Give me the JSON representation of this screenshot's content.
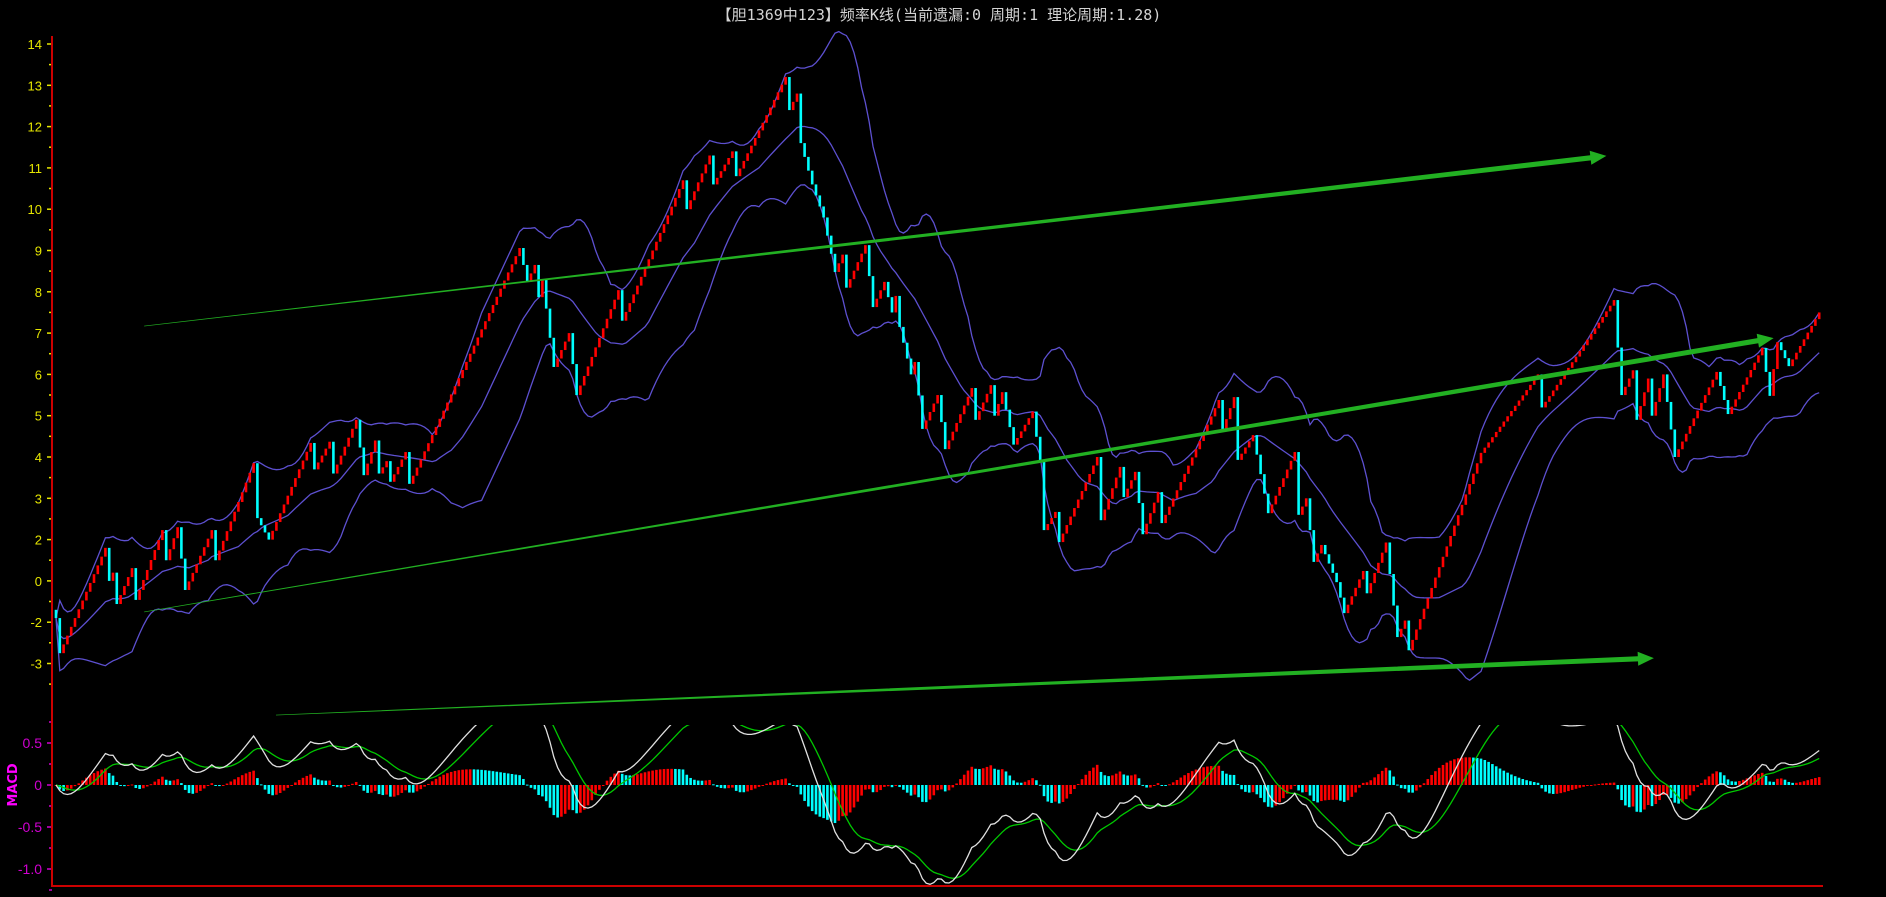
{
  "title": "【胆1369中123】频率K线(当前遗漏:0 周期:1 理论周期:1.28)",
  "colors": {
    "background": "#000000",
    "axis": "#cc0000",
    "price_tick": "#e6e600",
    "macd_tick": "#d000d0",
    "up_bar": "#ff0000",
    "down_bar": "#00ffff",
    "bands": "#5d50d0",
    "dif": "#e0e0e0",
    "dea": "#00c800",
    "trendline": "#22b022"
  },
  "chart_data": {
    "type": "candlestick",
    "title": "【胆1369中123】频率K线(当前遗漏:0 周期:1 理论周期:1.28)",
    "price_axis": {
      "range": [
        -1.9,
        14.2
      ],
      "ticks": [
        {
          "value": 14,
          "label": "14"
        },
        {
          "value": 13,
          "label": "13"
        },
        {
          "value": 12,
          "label": "12"
        },
        {
          "value": 11,
          "label": "11"
        },
        {
          "value": 10,
          "label": "10"
        },
        {
          "value": 9,
          "label": "9"
        },
        {
          "value": 8,
          "label": "8"
        },
        {
          "value": 7,
          "label": "7"
        },
        {
          "value": 6,
          "label": "6"
        },
        {
          "value": 5,
          "label": "5"
        },
        {
          "value": 4,
          "label": "4"
        },
        {
          "value": 3,
          "label": "3"
        },
        {
          "value": 2,
          "label": "2"
        },
        {
          "value": 1,
          "label": "0"
        },
        {
          "value": 0,
          "label": "-2"
        },
        {
          "value": -1,
          "label": "-3"
        }
      ]
    },
    "macd_axis": {
      "label": "MACD",
      "range": [
        -1.2,
        0.85
      ],
      "ticks": [
        {
          "value": 0.5,
          "label": "0.5"
        },
        {
          "value": 0,
          "label": "0"
        },
        {
          "value": -0.5,
          "label": "-0.5"
        },
        {
          "value": -1.0,
          "label": "-1.0"
        }
      ]
    },
    "bollinger": {
      "period": 20,
      "k": 2
    },
    "macd": {
      "fast": 12,
      "slow": 26,
      "signal": 9
    },
    "close_pivots": [
      [
        0,
        0.1
      ],
      [
        1,
        -0.75
      ],
      [
        13,
        1.8
      ],
      [
        14,
        1.0
      ],
      [
        15,
        1.2
      ],
      [
        16,
        0.44
      ],
      [
        20,
        1.31
      ],
      [
        21,
        0.54
      ],
      [
        28,
        2.23
      ],
      [
        29,
        1.5
      ],
      [
        32,
        2.3
      ],
      [
        34,
        0.78
      ],
      [
        41,
        2.23
      ],
      [
        42,
        1.5
      ],
      [
        52,
        3.85
      ],
      [
        53,
        2.52
      ],
      [
        56,
        2.0
      ],
      [
        67,
        4.34
      ],
      [
        68,
        3.7
      ],
      [
        72,
        4.37
      ],
      [
        73,
        3.6
      ],
      [
        79,
        4.9
      ],
      [
        81,
        3.56
      ],
      [
        84,
        4.4
      ],
      [
        85,
        3.6
      ],
      [
        87,
        3.9
      ],
      [
        88,
        3.4
      ],
      [
        92,
        4.12
      ],
      [
        93,
        3.35
      ],
      [
        122,
        9.06
      ],
      [
        124,
        8.24
      ],
      [
        126,
        8.65
      ],
      [
        127,
        7.87
      ],
      [
        128,
        8.3
      ],
      [
        131,
        6.18
      ],
      [
        135,
        7.0
      ],
      [
        137,
        5.5
      ],
      [
        148,
        8.04
      ],
      [
        149,
        7.3
      ],
      [
        165,
        10.7
      ],
      [
        166,
        10.0
      ],
      [
        172,
        11.3
      ],
      [
        173,
        10.6
      ],
      [
        178,
        11.4
      ],
      [
        179,
        10.8
      ],
      [
        192,
        13.2
      ],
      [
        193,
        12.4
      ],
      [
        195,
        12.8
      ],
      [
        196,
        11.6
      ],
      [
        199,
        10.6
      ],
      [
        202,
        9.8
      ],
      [
        205,
        8.48
      ],
      [
        207,
        8.9
      ],
      [
        208,
        8.1
      ],
      [
        213,
        9.13
      ],
      [
        215,
        7.63
      ],
      [
        218,
        8.24
      ],
      [
        220,
        7.5
      ],
      [
        221,
        7.9
      ],
      [
        222,
        7.15
      ],
      [
        225,
        6.0
      ],
      [
        226,
        6.3
      ],
      [
        228,
        4.68
      ],
      [
        232,
        5.5
      ],
      [
        234,
        4.19
      ],
      [
        241,
        5.67
      ],
      [
        242,
        4.9
      ],
      [
        246,
        5.74
      ],
      [
        247,
        5.0
      ],
      [
        249,
        5.57
      ],
      [
        252,
        4.3
      ],
      [
        257,
        5.1
      ],
      [
        259,
        3.88
      ],
      [
        260,
        2.23
      ],
      [
        263,
        2.67
      ],
      [
        264,
        1.94
      ],
      [
        274,
        4.0
      ],
      [
        275,
        2.47
      ],
      [
        280,
        3.76
      ],
      [
        281,
        3.03
      ],
      [
        284,
        3.64
      ],
      [
        286,
        2.13
      ],
      [
        290,
        3.15
      ],
      [
        291,
        2.4
      ],
      [
        306,
        5.38
      ],
      [
        307,
        4.65
      ],
      [
        310,
        5.45
      ],
      [
        311,
        3.93
      ],
      [
        315,
        4.53
      ],
      [
        319,
        2.64
      ],
      [
        326,
        4.12
      ],
      [
        327,
        2.6
      ],
      [
        329,
        3.0
      ],
      [
        331,
        1.46
      ],
      [
        333,
        1.87
      ],
      [
        337,
        0.97
      ],
      [
        339,
        0.22
      ],
      [
        344,
        1.24
      ],
      [
        345,
        0.7
      ],
      [
        350,
        1.93
      ],
      [
        353,
        -0.36
      ],
      [
        355,
        0.04
      ],
      [
        356,
        -0.68
      ],
      [
        375,
        4.1
      ],
      [
        390,
        6.0
      ],
      [
        391,
        5.2
      ],
      [
        410,
        7.8
      ],
      [
        412,
        5.5
      ],
      [
        415,
        6.1
      ],
      [
        416,
        4.9
      ],
      [
        419,
        5.9
      ],
      [
        420,
        5.0
      ],
      [
        423,
        6.0
      ],
      [
        426,
        4.0
      ],
      [
        437,
        6.06
      ],
      [
        440,
        5.04
      ],
      [
        449,
        6.64
      ],
      [
        451,
        5.48
      ],
      [
        453,
        6.78
      ],
      [
        456,
        6.2
      ],
      [
        464,
        7.5
      ]
    ],
    "trendlines": [
      {
        "from": [
          23.2,
          7.17
        ],
        "to": [
          408,
          11.29
        ]
      },
      {
        "from": [
          23.2,
          0.25
        ],
        "to": [
          452,
          6.88
        ]
      },
      {
        "from": [
          57.9,
          -2.25
        ],
        "to": [
          420.5,
          -0.87
        ]
      }
    ]
  }
}
